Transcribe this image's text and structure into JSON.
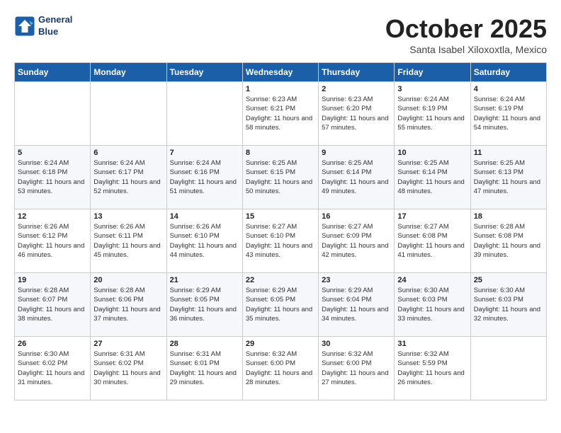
{
  "header": {
    "logo_line1": "General",
    "logo_line2": "Blue",
    "month": "October 2025",
    "location": "Santa Isabel Xiloxoxtla, Mexico"
  },
  "weekdays": [
    "Sunday",
    "Monday",
    "Tuesday",
    "Wednesday",
    "Thursday",
    "Friday",
    "Saturday"
  ],
  "weeks": [
    [
      {
        "day": "",
        "info": ""
      },
      {
        "day": "",
        "info": ""
      },
      {
        "day": "",
        "info": ""
      },
      {
        "day": "1",
        "info": "Sunrise: 6:23 AM\nSunset: 6:21 PM\nDaylight: 11 hours\nand 58 minutes."
      },
      {
        "day": "2",
        "info": "Sunrise: 6:23 AM\nSunset: 6:20 PM\nDaylight: 11 hours\nand 57 minutes."
      },
      {
        "day": "3",
        "info": "Sunrise: 6:24 AM\nSunset: 6:19 PM\nDaylight: 11 hours\nand 55 minutes."
      },
      {
        "day": "4",
        "info": "Sunrise: 6:24 AM\nSunset: 6:19 PM\nDaylight: 11 hours\nand 54 minutes."
      }
    ],
    [
      {
        "day": "5",
        "info": "Sunrise: 6:24 AM\nSunset: 6:18 PM\nDaylight: 11 hours\nand 53 minutes."
      },
      {
        "day": "6",
        "info": "Sunrise: 6:24 AM\nSunset: 6:17 PM\nDaylight: 11 hours\nand 52 minutes."
      },
      {
        "day": "7",
        "info": "Sunrise: 6:24 AM\nSunset: 6:16 PM\nDaylight: 11 hours\nand 51 minutes."
      },
      {
        "day": "8",
        "info": "Sunrise: 6:25 AM\nSunset: 6:15 PM\nDaylight: 11 hours\nand 50 minutes."
      },
      {
        "day": "9",
        "info": "Sunrise: 6:25 AM\nSunset: 6:14 PM\nDaylight: 11 hours\nand 49 minutes."
      },
      {
        "day": "10",
        "info": "Sunrise: 6:25 AM\nSunset: 6:14 PM\nDaylight: 11 hours\nand 48 minutes."
      },
      {
        "day": "11",
        "info": "Sunrise: 6:25 AM\nSunset: 6:13 PM\nDaylight: 11 hours\nand 47 minutes."
      }
    ],
    [
      {
        "day": "12",
        "info": "Sunrise: 6:26 AM\nSunset: 6:12 PM\nDaylight: 11 hours\nand 46 minutes."
      },
      {
        "day": "13",
        "info": "Sunrise: 6:26 AM\nSunset: 6:11 PM\nDaylight: 11 hours\nand 45 minutes."
      },
      {
        "day": "14",
        "info": "Sunrise: 6:26 AM\nSunset: 6:10 PM\nDaylight: 11 hours\nand 44 minutes."
      },
      {
        "day": "15",
        "info": "Sunrise: 6:27 AM\nSunset: 6:10 PM\nDaylight: 11 hours\nand 43 minutes."
      },
      {
        "day": "16",
        "info": "Sunrise: 6:27 AM\nSunset: 6:09 PM\nDaylight: 11 hours\nand 42 minutes."
      },
      {
        "day": "17",
        "info": "Sunrise: 6:27 AM\nSunset: 6:08 PM\nDaylight: 11 hours\nand 41 minutes."
      },
      {
        "day": "18",
        "info": "Sunrise: 6:28 AM\nSunset: 6:08 PM\nDaylight: 11 hours\nand 39 minutes."
      }
    ],
    [
      {
        "day": "19",
        "info": "Sunrise: 6:28 AM\nSunset: 6:07 PM\nDaylight: 11 hours\nand 38 minutes."
      },
      {
        "day": "20",
        "info": "Sunrise: 6:28 AM\nSunset: 6:06 PM\nDaylight: 11 hours\nand 37 minutes."
      },
      {
        "day": "21",
        "info": "Sunrise: 6:29 AM\nSunset: 6:05 PM\nDaylight: 11 hours\nand 36 minutes."
      },
      {
        "day": "22",
        "info": "Sunrise: 6:29 AM\nSunset: 6:05 PM\nDaylight: 11 hours\nand 35 minutes."
      },
      {
        "day": "23",
        "info": "Sunrise: 6:29 AM\nSunset: 6:04 PM\nDaylight: 11 hours\nand 34 minutes."
      },
      {
        "day": "24",
        "info": "Sunrise: 6:30 AM\nSunset: 6:03 PM\nDaylight: 11 hours\nand 33 minutes."
      },
      {
        "day": "25",
        "info": "Sunrise: 6:30 AM\nSunset: 6:03 PM\nDaylight: 11 hours\nand 32 minutes."
      }
    ],
    [
      {
        "day": "26",
        "info": "Sunrise: 6:30 AM\nSunset: 6:02 PM\nDaylight: 11 hours\nand 31 minutes."
      },
      {
        "day": "27",
        "info": "Sunrise: 6:31 AM\nSunset: 6:02 PM\nDaylight: 11 hours\nand 30 minutes."
      },
      {
        "day": "28",
        "info": "Sunrise: 6:31 AM\nSunset: 6:01 PM\nDaylight: 11 hours\nand 29 minutes."
      },
      {
        "day": "29",
        "info": "Sunrise: 6:32 AM\nSunset: 6:00 PM\nDaylight: 11 hours\nand 28 minutes."
      },
      {
        "day": "30",
        "info": "Sunrise: 6:32 AM\nSunset: 6:00 PM\nDaylight: 11 hours\nand 27 minutes."
      },
      {
        "day": "31",
        "info": "Sunrise: 6:32 AM\nSunset: 5:59 PM\nDaylight: 11 hours\nand 26 minutes."
      },
      {
        "day": "",
        "info": ""
      }
    ]
  ]
}
